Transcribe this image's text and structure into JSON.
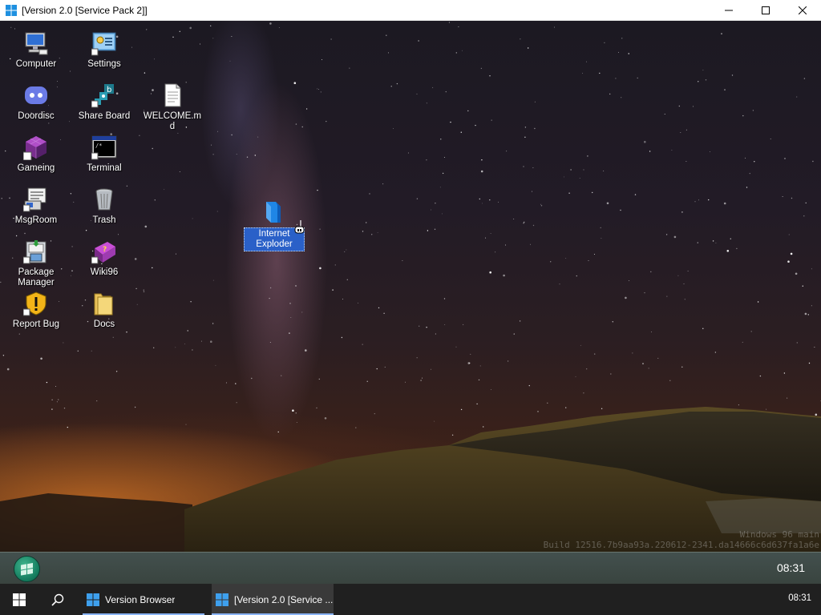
{
  "window": {
    "title": "[Version 2.0 [Service Pack 2]]",
    "controls": {
      "minimize": "—",
      "maximize": "☐",
      "close": "✕"
    }
  },
  "desktop": {
    "icons": [
      {
        "label": "Computer",
        "icon": "computer-icon"
      },
      {
        "label": "Settings",
        "icon": "settings-icon"
      },
      {
        "label": "Doordisc",
        "icon": "doordisc-icon"
      },
      {
        "label": "Share Board",
        "icon": "share-board-icon"
      },
      {
        "label": "WELCOME.md",
        "icon": "document-icon"
      },
      {
        "label": "Gameing",
        "icon": "gameing-icon"
      },
      {
        "label": "Terminal",
        "icon": "terminal-icon"
      },
      {
        "label": "MsgRoom",
        "icon": "msgroom-icon"
      },
      {
        "label": "Trash",
        "icon": "trash-icon"
      },
      {
        "label": "Package Manager",
        "icon": "package-manager-icon"
      },
      {
        "label": "Wiki96",
        "icon": "wiki96-icon"
      },
      {
        "label": "Report Bug",
        "icon": "report-bug-icon"
      },
      {
        "label": "Docs",
        "icon": "folder-icon"
      },
      {
        "label": "Internet Exploder",
        "icon": "internet-exploder-icon",
        "selected": true
      }
    ],
    "watermark": {
      "line1": "Windows 96 main",
      "line2": "Build 12516.7b9aa93a.220612-2341.da14666c6d637fa1a6e"
    }
  },
  "guest_taskbar": {
    "clock": "08:31"
  },
  "host_taskbar": {
    "apps": [
      {
        "label": "Version Browser",
        "active": false
      },
      {
        "label": "[Version 2.0 [Service ...",
        "active": true
      }
    ],
    "clock": "08:31"
  },
  "colors": {
    "selection": "#2a60c8",
    "guest_taskbar": "#3d4844",
    "host_taskbar": "#202020",
    "start_orb": "#1f9470"
  }
}
